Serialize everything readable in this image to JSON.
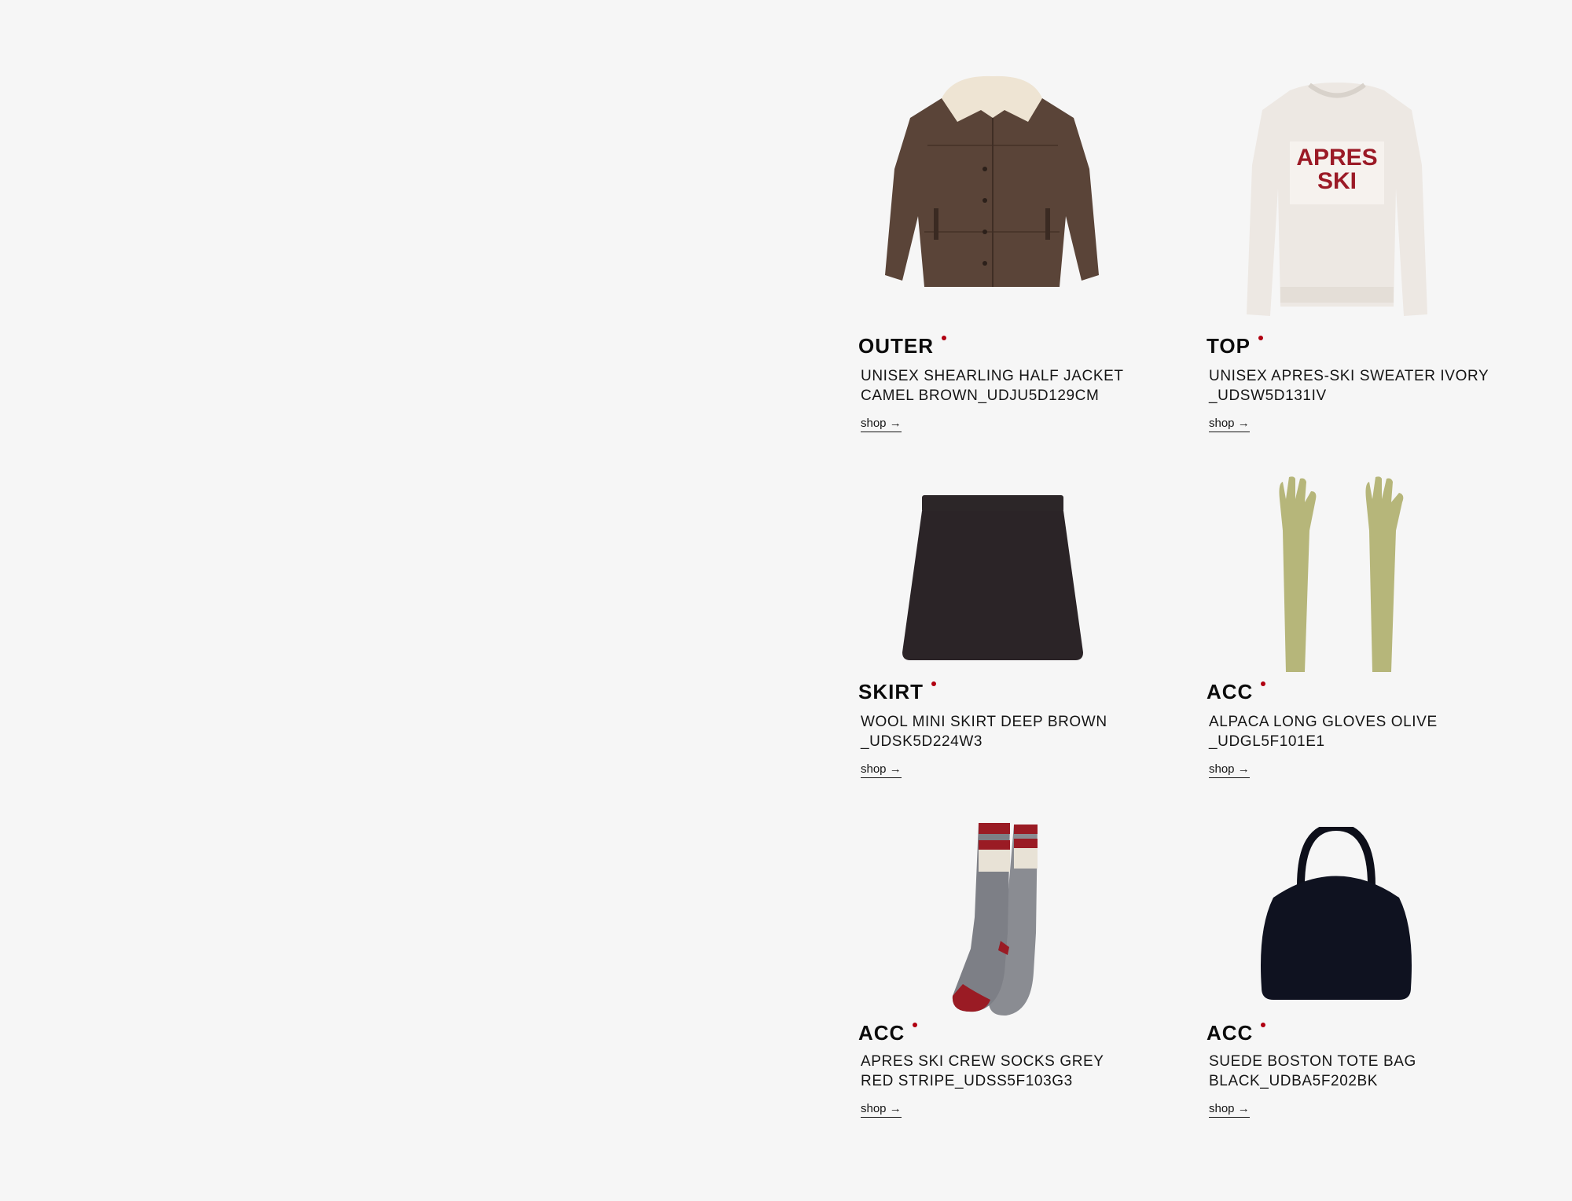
{
  "products": [
    {
      "category": "OUTER",
      "name_line1": "UNISEX SHEARLING HALF JACKET",
      "name_line2": "CAMEL BROWN_UDJU5D129CM",
      "shop_label": "shop →",
      "image": "shearling-jacket"
    },
    {
      "category": "TOP",
      "name_line1": "UNISEX APRES-SKI SWEATER IVORY",
      "name_line2": "_UDSW5D131IV",
      "shop_label": "shop →",
      "image": "apres-ski-sweater",
      "image_text_1": "APRES",
      "image_text_2": "SKI"
    },
    {
      "category": "SKIRT",
      "name_line1": "WOOL MINI SKIRT DEEP BROWN",
      "name_line2": "_UDSK5D224W3",
      "shop_label": "shop →",
      "image": "mini-skirt"
    },
    {
      "category": "ACC",
      "name_line1": "ALPACA LONG GLOVES OLIVE",
      "name_line2": "_UDGL5F101E1",
      "shop_label": "shop →",
      "image": "long-gloves"
    },
    {
      "category": "ACC",
      "name_line1": "APRES SKI CREW SOCKS GREY",
      "name_line2": "RED STRIPE_UDSS5F103G3",
      "shop_label": "shop →",
      "image": "crew-socks"
    },
    {
      "category": "ACC",
      "name_line1": "SUEDE BOSTON TOTE BAG",
      "name_line2": "BLACK_UDBA5F202BK",
      "shop_label": "shop →",
      "image": "boston-bag"
    }
  ],
  "colors": {
    "background": "#f6f6f6",
    "accent_dot": "#b00010",
    "text": "#111111"
  }
}
